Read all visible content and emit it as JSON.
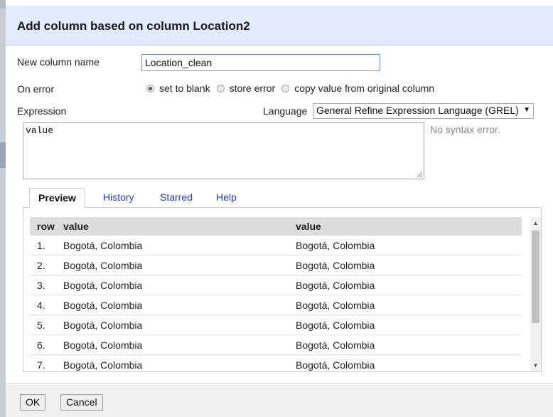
{
  "dialog": {
    "title": "Add column based on column Location2",
    "new_column_label": "New column name",
    "new_column_value": "Location_clean",
    "on_error_label": "On error",
    "on_error_options": [
      "set to blank",
      "store error",
      "copy value from original column"
    ],
    "on_error_selected": "set to blank",
    "expression_label": "Expression",
    "language_label": "Language",
    "language_value": "General Refine Expression Language (GREL)",
    "expression_value": "value",
    "syntax_status": "No syntax error."
  },
  "tabs": [
    {
      "label": "Preview",
      "active": true
    },
    {
      "label": "History"
    },
    {
      "label": "Starred"
    },
    {
      "label": "Help"
    }
  ],
  "preview": {
    "headers": [
      "row",
      "value",
      "value"
    ],
    "rows": [
      [
        "1.",
        "Bogotá, Colombia",
        "Bogotá, Colombia"
      ],
      [
        "2.",
        "Bogotá, Colombia",
        "Bogotá, Colombia"
      ],
      [
        "3.",
        "Bogotá, Colombia",
        "Bogotá, Colombia"
      ],
      [
        "4.",
        "Bogotá, Colombia",
        "Bogotá, Colombia"
      ],
      [
        "5.",
        "Bogotá, Colombia",
        "Bogotá, Colombia"
      ],
      [
        "6.",
        "Bogotá, Colombia",
        "Bogotá, Colombia"
      ],
      [
        "7.",
        "Bogotá, Colombia",
        "Bogotá, Colombia"
      ]
    ]
  },
  "footer": {
    "ok_label": "OK",
    "cancel_label": "Cancel"
  },
  "colors": {
    "header_bg": "#e3e9ff",
    "link": "#1f3fbf",
    "input_border": "#6b8fd8"
  },
  "icons": {
    "dropdown": "triangle-down-icon",
    "scroll_up": "triangle-up-icon",
    "scroll_down": "triangle-down-icon"
  }
}
